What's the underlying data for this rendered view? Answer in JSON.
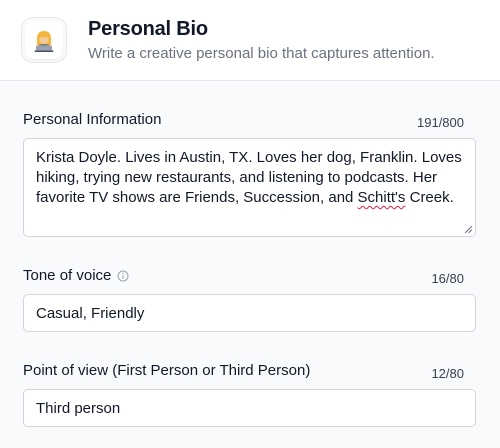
{
  "header": {
    "icon": "person-laptop-icon",
    "title": "Personal Bio",
    "subtitle": "Write a creative personal bio that captures attention."
  },
  "fields": {
    "personal_info": {
      "label": "Personal Information",
      "counter": "191/800",
      "value_before": "Krista Doyle. Lives in Austin, TX. Loves her dog, Franklin. Loves hiking, trying new restaurants, and listening to podcasts. Her favorite TV shows are Friends, Succession, and ",
      "value_misspelled": "Schitt's",
      "value_after": " Creek."
    },
    "tone": {
      "label": "Tone of voice",
      "info_icon": "info-circle-icon",
      "counter": "16/80",
      "value": "Casual, Friendly"
    },
    "pov": {
      "label": "Point of view (First Person or Third Person)",
      "counter": "12/80",
      "value": "Third person"
    }
  },
  "colors": {
    "spellcheck_underline": "#e11d48",
    "border": "#d1d5db",
    "muted_text": "#6b7280"
  }
}
